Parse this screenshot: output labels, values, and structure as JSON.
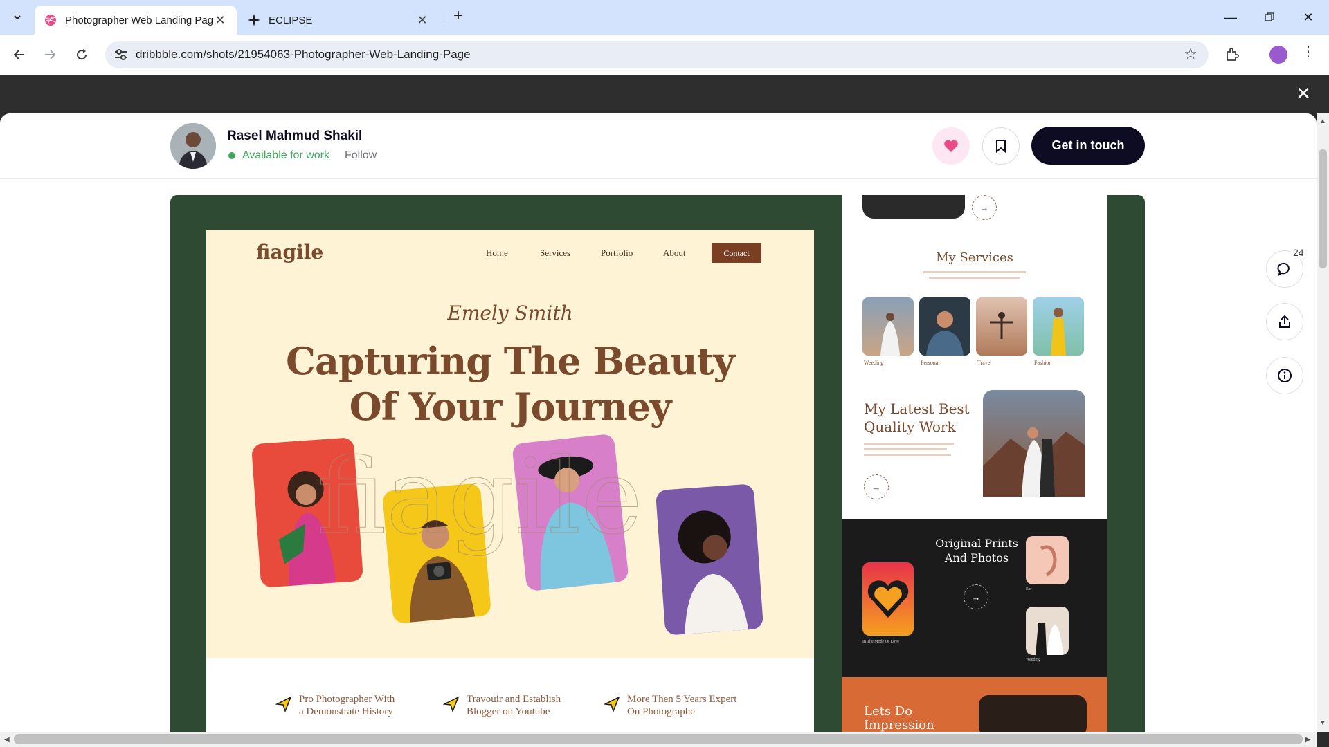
{
  "browser": {
    "tabs": [
      {
        "title": "Photographer Web Landing Pag",
        "active": true
      },
      {
        "title": "ECLIPSE",
        "active": false
      }
    ],
    "url": "dribbble.com/shots/21954063-Photographer-Web-Landing-Page"
  },
  "shot_header": {
    "author": "Rasel Mahmud Shakil",
    "availability": "Available for work",
    "follow": "Follow",
    "cta": "Get in touch"
  },
  "side_actions": {
    "comment_count": "24"
  },
  "landing": {
    "logo": "fiagile",
    "nav": [
      "Home",
      "Services",
      "Portfolio",
      "About"
    ],
    "contact": "Contact",
    "script_name": "Emely Smith",
    "headline_line1": "Capturing The Beauty",
    "headline_line2": "Of Your Journey",
    "ghost_text": "fiagile",
    "features": [
      {
        "line1": "Pro Photographer With",
        "line2": "a Demonstrate History"
      },
      {
        "line1": "Travouir and Establish",
        "line2": "Blogger on Youtube"
      },
      {
        "line1": "More Then 5 Years Expert",
        "line2": "On Photographe"
      }
    ]
  },
  "right_column": {
    "services_title": "My Services",
    "services": [
      "Weeding",
      "Personal",
      "Travel",
      "Fashion"
    ],
    "latest_title_1": "My Latest Best",
    "latest_title_2": "Quality Work",
    "prints_title_1": "Original Prints",
    "prints_title_2": "And Photos",
    "prints_caption_1": "In The Mode Of Love",
    "prints_caption_2": "Ear",
    "prints_caption_3": "Weeding",
    "impression_1": "Lets Do",
    "impression_2": "Impression"
  },
  "colors": {
    "dribbble_pink": "#ea4c89",
    "accent_brown": "#7b4a2c",
    "shot_bg": "#2f4a32",
    "cta_bg": "#0d0c22",
    "available_green": "#3fa75d"
  }
}
